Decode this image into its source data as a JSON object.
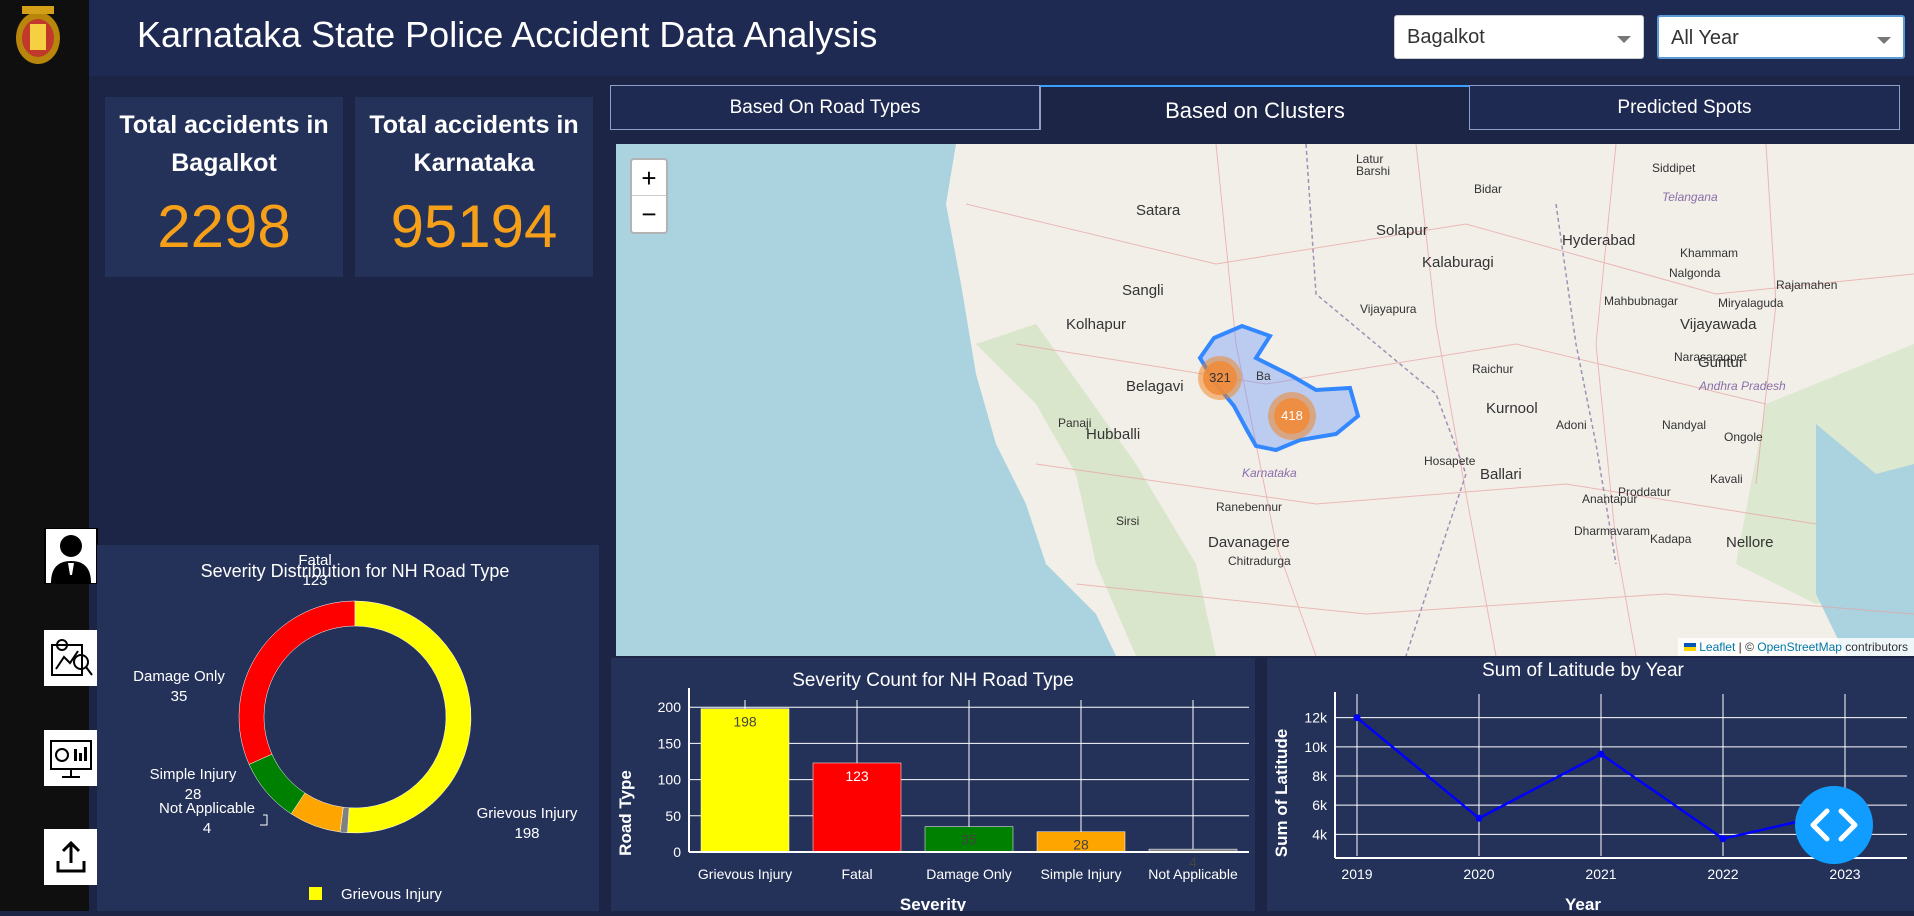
{
  "header": {
    "title": "Karnataka State Police Accident Data Analysis",
    "district_select": "Bagalkot",
    "year_select": "All Year"
  },
  "cards": [
    {
      "title_line1": "Total accidents in",
      "title_line2": "Bagalkot",
      "value": "2298"
    },
    {
      "title_line1": "Total accidents in",
      "title_line2": "Karnataka",
      "value": "95194"
    }
  ],
  "tabs": [
    "Based On Road Types",
    "Based on Clusters",
    "Predicted Spots"
  ],
  "map": {
    "zoom_in": "+",
    "zoom_out": "−",
    "attribution_leaflet": "Leaflet",
    "attribution_sep": " | © ",
    "attribution_osm": "OpenStreetMap",
    "attribution_tail": " contributors",
    "clusters": [
      "321",
      "418"
    ],
    "places": [
      {
        "name": "Latur"
      },
      {
        "name": "Barshi"
      },
      {
        "name": "Siddipet"
      },
      {
        "name": "Bidar"
      },
      {
        "name": "Telangana"
      },
      {
        "name": "Satara"
      },
      {
        "name": "Solapur"
      },
      {
        "name": "Hyderabad"
      },
      {
        "name": "Khammam"
      },
      {
        "name": "Kalaburagi"
      },
      {
        "name": "Nalgonda"
      },
      {
        "name": "Rajamahen"
      },
      {
        "name": "Sangli"
      },
      {
        "name": "Vijayapura"
      },
      {
        "name": "Mahbubnagar"
      },
      {
        "name": "Miryalaguda"
      },
      {
        "name": "Kolhapur"
      },
      {
        "name": "Vijayawada"
      },
      {
        "name": "Narasaraopet"
      },
      {
        "name": "Guntur"
      },
      {
        "name": "Belagavi"
      },
      {
        "name": "Raichur"
      },
      {
        "name": "Andhra Pradesh"
      },
      {
        "name": "Kurnool"
      },
      {
        "name": "Panaji"
      },
      {
        "name": "Adoni"
      },
      {
        "name": "Nandyal"
      },
      {
        "name": "Ongole"
      },
      {
        "name": "Hubballi"
      },
      {
        "name": "Hosapete"
      },
      {
        "name": "Karnataka"
      },
      {
        "name": "Ballari"
      },
      {
        "name": "Kavali"
      },
      {
        "name": "Proddatur"
      },
      {
        "name": "Anantapur"
      },
      {
        "name": "Ranebennur"
      },
      {
        "name": "Sirsi"
      },
      {
        "name": "Dharmavaram"
      },
      {
        "name": "Davanagere"
      },
      {
        "name": "Nellore"
      },
      {
        "name": "Kadapa"
      },
      {
        "name": "Chitradurga"
      },
      {
        "name": "Ba"
      }
    ]
  },
  "donut": {
    "title": "Severity Distribution for NH Road Type",
    "legend": "Grievous Injury",
    "colors": [
      "#ffff00",
      "#ff0000",
      "#008000",
      "#ffa500",
      "#808080"
    ]
  },
  "severity_bar": {
    "title": "Severity Count for NH Road Type",
    "xlabel": "Severity",
    "ylabel": "Road Type",
    "yticks": [
      "0",
      "50",
      "100",
      "150",
      "200"
    ]
  },
  "latitude_line": {
    "title": "Sum of Latitude by Year",
    "xlabel": "Year",
    "ylabel": "Sum of Latitude",
    "yticks": [
      "4k",
      "6k",
      "8k",
      "10k",
      "12k"
    ],
    "xticks": [
      "2019",
      "2020",
      "2021",
      "2022",
      "2023"
    ]
  },
  "chart_data": [
    {
      "type": "pie",
      "title": "Severity Distribution for NH Road Type",
      "categories": [
        "Grievous Injury",
        "Fatal",
        "Damage Only",
        "Simple Injury",
        "Not Applicable"
      ],
      "values": [
        198,
        123,
        35,
        28,
        4
      ],
      "hole": true,
      "legend_position": "bottom"
    },
    {
      "type": "bar",
      "title": "Severity Count for NH Road Type",
      "categories": [
        "Grievous Injury",
        "Fatal",
        "Damage Only",
        "Simple Injury",
        "Not Applicable"
      ],
      "values": [
        198,
        123,
        35,
        28,
        4
      ],
      "xlabel": "Severity",
      "ylabel": "Road Type",
      "ylim": [
        0,
        210
      ],
      "grid": true
    },
    {
      "type": "line",
      "title": "Sum of Latitude by Year",
      "x": [
        2019,
        2020,
        2021,
        2022,
        2023
      ],
      "values": [
        12000,
        5100,
        9500,
        3700,
        5600
      ],
      "xlabel": "Year",
      "ylabel": "Sum of Latitude",
      "ylim": [
        3000,
        13000
      ],
      "grid": true
    }
  ]
}
